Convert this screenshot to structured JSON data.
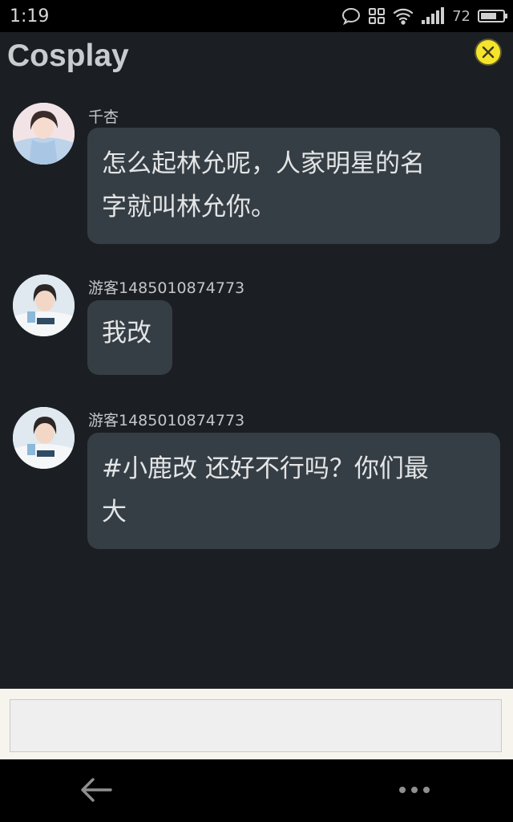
{
  "status_bar": {
    "time": "1:19",
    "battery_percent": "72",
    "battery_level": 0.72,
    "icons": [
      "chat-bubble-icon",
      "grid-icon",
      "wifi-icon",
      "signal-icon",
      "battery-icon"
    ]
  },
  "header": {
    "title": "Cosplay",
    "close_icon": "close-icon",
    "close_color": "#f6e32c"
  },
  "messages": [
    {
      "sender": "千杏",
      "avatar": "avatar-girl-blue-dress",
      "text_lines": [
        "怎么起林允呢，人家明星的名",
        "字就叫林允你。"
      ]
    },
    {
      "sender": "游客1485010874773",
      "avatar": "avatar-girl-white-shirt",
      "text_lines": [
        "我改"
      ]
    },
    {
      "sender": "游客1485010874773",
      "avatar": "avatar-girl-white-shirt",
      "text_lines": [
        "#小鹿改 还好不行吗？你们最",
        "大"
      ]
    }
  ],
  "input": {
    "placeholder": ""
  },
  "nav_bar": {
    "back_icon": "back-arrow-icon",
    "more_icon": "more-dots-icon"
  },
  "colors": {
    "background": "#1b1e23",
    "bubble": "#363e45",
    "bubble_text": "#e3e5e6",
    "input_bar": "#f6f4ec"
  }
}
